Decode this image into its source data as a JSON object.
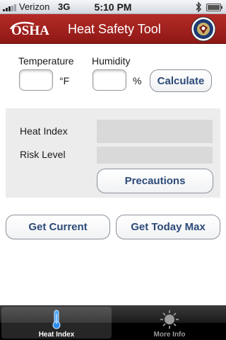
{
  "status_bar": {
    "carrier": "Verizon",
    "network": "3G",
    "time": "5:10 PM"
  },
  "header": {
    "logo_text": "OSHA",
    "title": "Heat Safety Tool"
  },
  "inputs": {
    "temperature_label": "Temperature",
    "temperature_unit": "°F",
    "temperature_value": "",
    "humidity_label": "Humidity",
    "humidity_unit": "%",
    "humidity_value": "",
    "calculate_label": "Calculate"
  },
  "results": {
    "heat_index_label": "Heat Index",
    "heat_index_value": "",
    "risk_level_label": "Risk Level",
    "risk_level_value": "",
    "precautions_label": "Precautions"
  },
  "actions": {
    "get_current_label": "Get Current",
    "get_today_max_label": "Get Today Max"
  },
  "tab_bar": {
    "tabs": [
      {
        "label": "Heat Index",
        "icon": "thermometer-icon",
        "active": true
      },
      {
        "label": "More Info",
        "icon": "sun-icon",
        "active": false
      }
    ]
  },
  "colors": {
    "header_red": "#a3221f",
    "button_text": "#2c4a78",
    "panel_gray": "#ececec"
  }
}
